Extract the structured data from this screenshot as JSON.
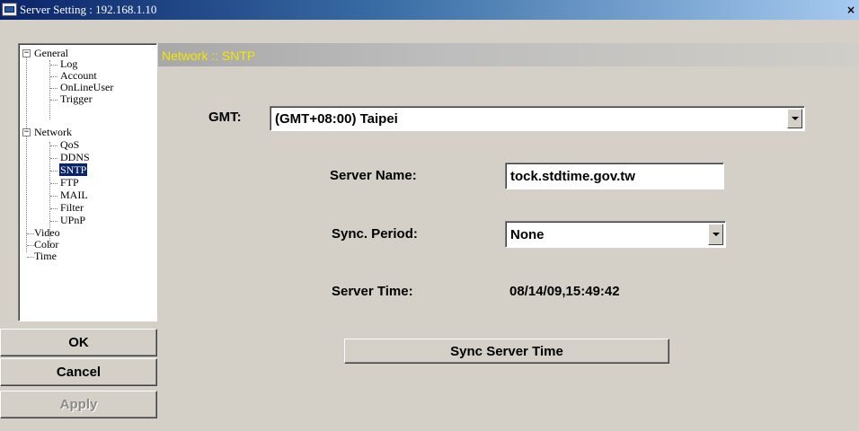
{
  "window": {
    "title": "Server Setting : 192.168.1.10",
    "close_label": "×"
  },
  "tree": {
    "general": {
      "label": "General",
      "expanded": true,
      "children": [
        "Log",
        "Account",
        "OnLineUser",
        "Trigger"
      ]
    },
    "network": {
      "label": "Network",
      "expanded": true,
      "children": [
        "QoS",
        "DDNS",
        "SNTP",
        "FTP",
        "MAIL",
        "Filter",
        "UPnP"
      ],
      "selected": "SNTP"
    },
    "others": [
      "Video",
      "Color",
      "Time"
    ]
  },
  "buttons": {
    "ok": "OK",
    "cancel": "Cancel",
    "apply": "Apply"
  },
  "section": {
    "title": "Network :: SNTP",
    "title_color": "#f4e600"
  },
  "form": {
    "gmt_label": "GMT:",
    "gmt_value": "(GMT+08:00) Taipei",
    "server_name_label": "Server Name:",
    "server_name_value": "tock.stdtime.gov.tw",
    "sync_period_label": "Sync. Period:",
    "sync_period_value": "None",
    "server_time_label": "Server Time:",
    "server_time_value": "08/14/09,15:49:42",
    "sync_button": "Sync Server Time"
  }
}
